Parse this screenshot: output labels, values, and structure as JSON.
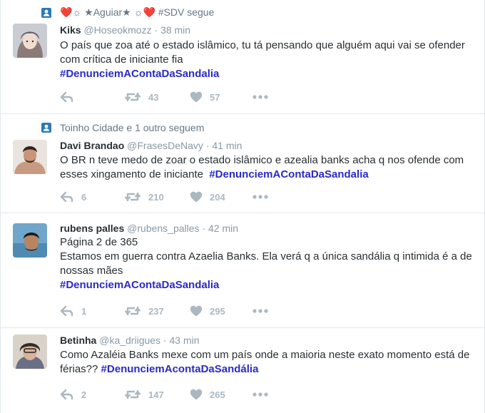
{
  "tweets": [
    {
      "context": "❤️☼ ★Aguiar★ ☼❤️ #SDV segue",
      "fullname": "Kiks",
      "username": "@Hoseokmozz",
      "dot": "·",
      "time": "38 min",
      "text": "O país que zoa até o estado islâmico, tu tá pensando que alguém aqui vai se ofender com crítica de iniciante fia",
      "hashtag": "#DenunciemAContaDaSandalia",
      "replies": "",
      "retweets": "43",
      "likes": "57"
    },
    {
      "context": "Toinho Cidade e 1 outro seguem",
      "fullname": "Davi Brandao",
      "username": "@FrasesDeNavy",
      "dot": "·",
      "time": "41 min",
      "text": "O BR n teve medo de zoar o estado islâmico e azealia banks acha q nos ofende com esses xingamento de iniciante",
      "hashtag": "#DenunciemAContaDaSandalia",
      "replies": "6",
      "retweets": "210",
      "likes": "204"
    },
    {
      "fullname": "rubens palles",
      "username": "@rubens_palles",
      "dot": "·",
      "time": "42 min",
      "line1": "Página 2 de 365",
      "text": "Estamos em guerra contra Azaelia Banks. Ela verá q a única sandália q intimida é a de nossas mães",
      "hashtag": "#DenunciemAContaDaSandalia",
      "replies": "1",
      "retweets": "237",
      "likes": "295"
    },
    {
      "fullname": "Betinha",
      "username": "@ka_driigues",
      "dot": "·",
      "time": "43 min",
      "text": "Como Azaléia Banks mexe com um país onde a maioria neste exato momento está de férias??",
      "hashtag": "#DenunciemAcontaDaSandália",
      "replies": "2",
      "retweets": "147",
      "likes": "265"
    }
  ],
  "icons": {
    "context": "person-badge-icon",
    "reply": "reply-arrow-icon",
    "retweet": "retweet-icon",
    "like": "heart-icon",
    "more": "more-dots-icon"
  },
  "colors": {
    "hashtag": "#2a2ac7",
    "muted": "#8899a6",
    "action": "#aab8c2",
    "context_badge": "#2b7bb9",
    "divider": "#e1e8ed"
  }
}
